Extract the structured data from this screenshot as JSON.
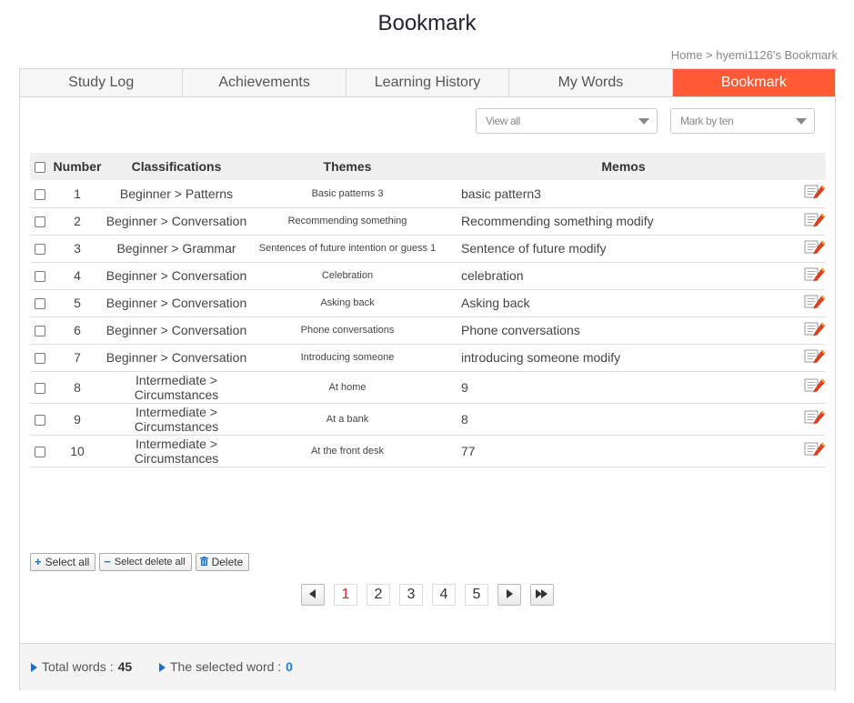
{
  "page": {
    "title": "Bookmark",
    "breadcrumb": "Home > hyemi1126's Bookmark"
  },
  "tabs": [
    {
      "label": "Study Log",
      "active": false
    },
    {
      "label": "Achievements",
      "active": false
    },
    {
      "label": "Learning History",
      "active": false
    },
    {
      "label": "My Words",
      "active": false
    },
    {
      "label": "Bookmark",
      "active": true
    }
  ],
  "filters": {
    "view_selected": "View all",
    "mark_selected": "Mark by ten"
  },
  "table": {
    "headers": {
      "number": "Number",
      "classification": "Classifications",
      "theme": "Themes",
      "memo": "Memos"
    },
    "rows": [
      {
        "number": "1",
        "classification": "Beginner > Patterns",
        "theme": "Basic patterns 3",
        "memo": "basic pattern3"
      },
      {
        "number": "2",
        "classification": "Beginner > Conversation",
        "theme": "Recommending something",
        "memo": "Recommending something modify"
      },
      {
        "number": "3",
        "classification": "Beginner > Grammar",
        "theme": "Sentences of future intention or guess 1",
        "memo": "Sentence of future modify"
      },
      {
        "number": "4",
        "classification": "Beginner > Conversation",
        "theme": "Celebration",
        "memo": "celebration"
      },
      {
        "number": "5",
        "classification": "Beginner > Conversation",
        "theme": "Asking back",
        "memo": "Asking back"
      },
      {
        "number": "6",
        "classification": "Beginner > Conversation",
        "theme": "Phone conversations",
        "memo": "Phone conversations"
      },
      {
        "number": "7",
        "classification": "Beginner > Conversation",
        "theme": "Introducing someone",
        "memo": "introducing someone modify"
      },
      {
        "number": "8",
        "classification": "Intermediate > Circumstances",
        "theme": "At home",
        "memo": "9"
      },
      {
        "number": "9",
        "classification": "Intermediate > Circumstances",
        "theme": "At a bank",
        "memo": "8"
      },
      {
        "number": "10",
        "classification": "Intermediate > Circumstances",
        "theme": "At the front desk",
        "memo": "77"
      }
    ]
  },
  "actions": {
    "select_all": "Select all",
    "select_delete_all": "Select delete all",
    "delete": "Delete"
  },
  "pagination": {
    "pages": [
      "1",
      "2",
      "3",
      "4",
      "5"
    ],
    "current": "1"
  },
  "footer": {
    "total_label": "Total words :",
    "total_value": "45",
    "selected_label": "The selected word :",
    "selected_value": "0"
  },
  "colors": {
    "active_tab": "#ff5a36",
    "link_blue": "#1a7fd6",
    "current_page": "#e3232c"
  }
}
